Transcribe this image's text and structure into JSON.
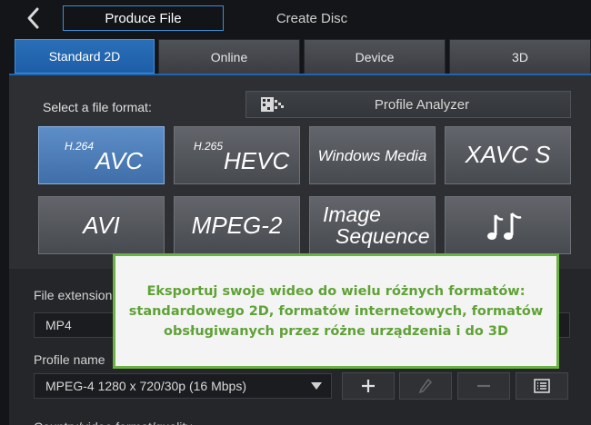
{
  "header": {
    "tabs": [
      {
        "label": "Produce File",
        "active": true
      },
      {
        "label": "Create Disc",
        "active": false
      }
    ]
  },
  "subtabs": [
    {
      "label": "Standard 2D",
      "active": true
    },
    {
      "label": "Online",
      "active": false
    },
    {
      "label": "Device",
      "active": false
    },
    {
      "label": "3D",
      "active": false
    }
  ],
  "format_section": {
    "label": "Select a file format:",
    "analyzer_label": "Profile Analyzer"
  },
  "formats": {
    "avc": {
      "sup": "H.264",
      "label": "AVC",
      "selected": true
    },
    "hevc": {
      "sup": "H.265",
      "label": "HEVC"
    },
    "wmv": {
      "label": "Windows Media"
    },
    "xavc": {
      "label": "XAVC S"
    },
    "avi": {
      "label": "AVI"
    },
    "mpeg2": {
      "label": "MPEG-2"
    },
    "image_seq": {
      "line1": "Image",
      "line2": "Sequence"
    },
    "audio": {
      "icon": "music-notes-icon"
    }
  },
  "settings": {
    "file_extension_label": "File extension",
    "file_extension_value": "MP4",
    "profile_name_label": "Profile name",
    "profile_value": "MPEG-4 1280 x 720/30p (16 Mbps)",
    "partial_label": "Country/video format/quality"
  },
  "callout": {
    "text": "Eksportuj swoje wideo do wielu różnych formatów: standardowego 2D, formatów internetowych, formatów obsługiwanych przez różne urządzenia i do 3D"
  },
  "colors": {
    "accent_blue": "#2a6fb8",
    "callout_green": "#6bb244",
    "callout_text": "#5fa236"
  }
}
